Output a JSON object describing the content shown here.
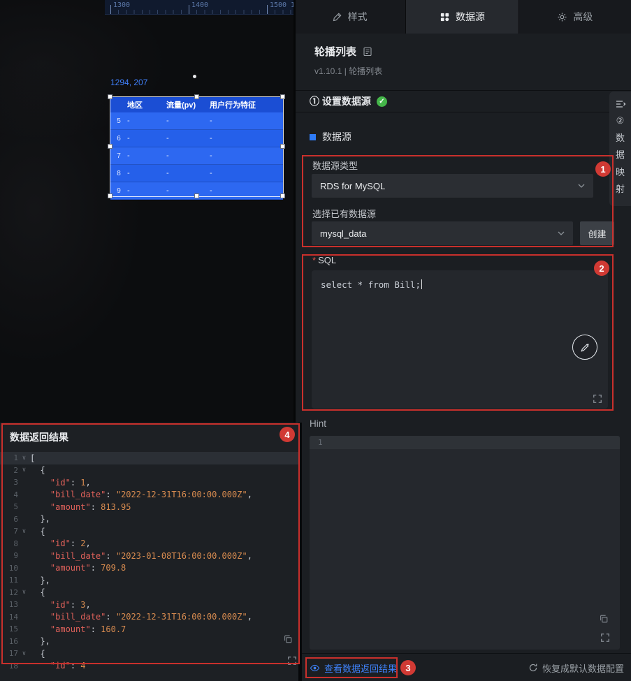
{
  "canvas": {
    "ruler_labels": [
      "1300",
      "1400",
      "1500",
      "1"
    ],
    "selection_coords": "1294, 207",
    "table": {
      "headers": [
        "地区",
        "流量(pv)",
        "用户行为特征"
      ],
      "rows": [
        {
          "index": "5",
          "cells": [
            "-",
            "-",
            "-"
          ]
        },
        {
          "index": "6",
          "cells": [
            "-",
            "-",
            "-"
          ]
        },
        {
          "index": "7",
          "cells": [
            "-",
            "-",
            "-"
          ]
        },
        {
          "index": "8",
          "cells": [
            "-",
            "-",
            "-"
          ]
        },
        {
          "index": "9",
          "cells": [
            "-",
            "-",
            "-"
          ]
        }
      ]
    }
  },
  "panel": {
    "tabs": [
      {
        "label": "样式",
        "active": false
      },
      {
        "label": "数据源",
        "active": true
      },
      {
        "label": "高级",
        "active": false
      }
    ],
    "widget": {
      "title": "轮播列表",
      "version": "v1.10.1 | 轮播列表"
    },
    "step1": {
      "label": "① 设置数据源"
    },
    "mapping_tab": {
      "step": "②",
      "label": "数据映射"
    },
    "datasource": {
      "section_label": "数据源",
      "type_label": "数据源类型",
      "type_value": "RDS for MySQL",
      "existing_label": "选择已有数据源",
      "existing_value": "mysql_data",
      "create_button": "创建"
    },
    "sql": {
      "required_mark": "*",
      "label": "SQL",
      "code": "select * from Bill;"
    }
  },
  "hint": {
    "title": "Hint",
    "line_number": "1"
  },
  "result_panel": {
    "title": "数据返回结果",
    "editor_lines": [
      {
        "n": "1",
        "fold": true,
        "tokens": [
          {
            "c": "p",
            "t": "["
          }
        ]
      },
      {
        "n": "2",
        "fold": true,
        "tokens": [
          {
            "c": "p",
            "t": "  {"
          }
        ]
      },
      {
        "n": "3",
        "tokens": [
          {
            "c": "p",
            "t": "    "
          },
          {
            "c": "k",
            "t": "\"id\""
          },
          {
            "c": "p",
            "t": ": "
          },
          {
            "c": "n",
            "t": "1"
          },
          {
            "c": "p",
            "t": ","
          }
        ]
      },
      {
        "n": "4",
        "tokens": [
          {
            "c": "p",
            "t": "    "
          },
          {
            "c": "k",
            "t": "\"bill_date\""
          },
          {
            "c": "p",
            "t": ": "
          },
          {
            "c": "s",
            "t": "\"2022-12-31T16:00:00.000Z\""
          },
          {
            "c": "p",
            "t": ","
          }
        ]
      },
      {
        "n": "5",
        "tokens": [
          {
            "c": "p",
            "t": "    "
          },
          {
            "c": "k",
            "t": "\"amount\""
          },
          {
            "c": "p",
            "t": ": "
          },
          {
            "c": "n",
            "t": "813.95"
          }
        ]
      },
      {
        "n": "6",
        "tokens": [
          {
            "c": "p",
            "t": "  },"
          }
        ]
      },
      {
        "n": "7",
        "fold": true,
        "tokens": [
          {
            "c": "p",
            "t": "  {"
          }
        ]
      },
      {
        "n": "8",
        "tokens": [
          {
            "c": "p",
            "t": "    "
          },
          {
            "c": "k",
            "t": "\"id\""
          },
          {
            "c": "p",
            "t": ": "
          },
          {
            "c": "n",
            "t": "2"
          },
          {
            "c": "p",
            "t": ","
          }
        ]
      },
      {
        "n": "9",
        "tokens": [
          {
            "c": "p",
            "t": "    "
          },
          {
            "c": "k",
            "t": "\"bill_date\""
          },
          {
            "c": "p",
            "t": ": "
          },
          {
            "c": "s",
            "t": "\"2023-01-08T16:00:00.000Z\""
          },
          {
            "c": "p",
            "t": ","
          }
        ]
      },
      {
        "n": "10",
        "tokens": [
          {
            "c": "p",
            "t": "    "
          },
          {
            "c": "k",
            "t": "\"amount\""
          },
          {
            "c": "p",
            "t": ": "
          },
          {
            "c": "n",
            "t": "709.8"
          }
        ]
      },
      {
        "n": "11",
        "tokens": [
          {
            "c": "p",
            "t": "  },"
          }
        ]
      },
      {
        "n": "12",
        "fold": true,
        "tokens": [
          {
            "c": "p",
            "t": "  {"
          }
        ]
      },
      {
        "n": "13",
        "tokens": [
          {
            "c": "p",
            "t": "    "
          },
          {
            "c": "k",
            "t": "\"id\""
          },
          {
            "c": "p",
            "t": ": "
          },
          {
            "c": "n",
            "t": "3"
          },
          {
            "c": "p",
            "t": ","
          }
        ]
      },
      {
        "n": "14",
        "tokens": [
          {
            "c": "p",
            "t": "    "
          },
          {
            "c": "k",
            "t": "\"bill_date\""
          },
          {
            "c": "p",
            "t": ": "
          },
          {
            "c": "s",
            "t": "\"2022-12-31T16:00:00.000Z\""
          },
          {
            "c": "p",
            "t": ","
          }
        ]
      },
      {
        "n": "15",
        "tokens": [
          {
            "c": "p",
            "t": "    "
          },
          {
            "c": "k",
            "t": "\"amount\""
          },
          {
            "c": "p",
            "t": ": "
          },
          {
            "c": "n",
            "t": "160.7"
          }
        ]
      },
      {
        "n": "16",
        "tokens": [
          {
            "c": "p",
            "t": "  },"
          }
        ]
      },
      {
        "n": "17",
        "fold": true,
        "tokens": [
          {
            "c": "p",
            "t": "  {"
          }
        ]
      },
      {
        "n": "18",
        "tokens": [
          {
            "c": "p",
            "t": "    "
          },
          {
            "c": "k",
            "t": "\"id\""
          },
          {
            "c": "p",
            "t": ": "
          },
          {
            "c": "n",
            "t": "4"
          }
        ]
      }
    ]
  },
  "footer": {
    "view_result_label": "查看数据返回结果",
    "restore_label": "恢复成默认数据配置"
  },
  "annotations": {
    "badge1": "1",
    "badge2": "2",
    "badge3": "3",
    "badge4": "4"
  },
  "colors": {
    "accent_blue": "#3e80f6",
    "annotation_red": "#c9302c",
    "check_green": "#44b549",
    "table_header_blue": "#1b4ed4",
    "table_row_blue": "#2d68f1"
  }
}
